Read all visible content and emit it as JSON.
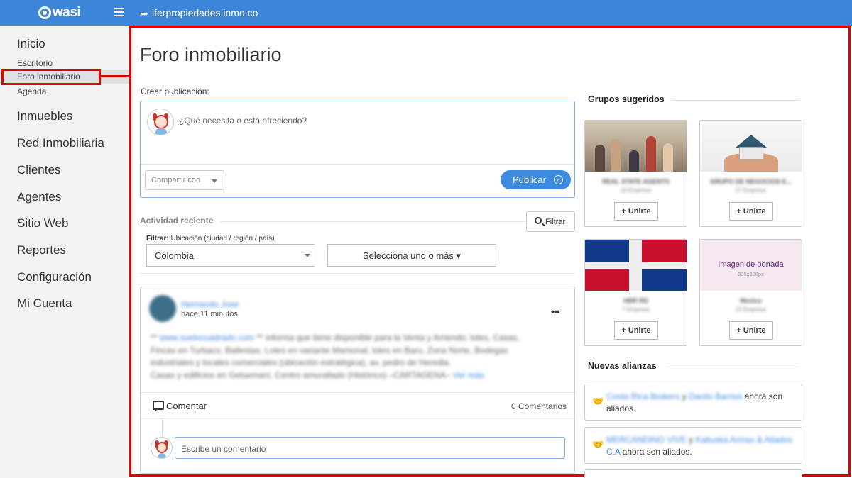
{
  "topbar": {
    "logo_text": "wasi",
    "domain": "iferpropiedades.inmo.co",
    "icons": [
      "menu-icon",
      "share-arrow-icon"
    ],
    "color": "#3d85d8"
  },
  "sidebar": {
    "section_inicio": "Inicio",
    "sub_escritorio": "Escritorio",
    "sub_foro": "Foro inmobiliario",
    "sub_agenda": "Agenda",
    "items": [
      "Inmuebles",
      "Red Inmobiliaria",
      "Clientes",
      "Agentes",
      "Sitio Web",
      "Reportes",
      "Configuración",
      "Mi Cuenta"
    ]
  },
  "main": {
    "title": "Foro inmobiliario",
    "create_label": "Crear publicación:",
    "post_placeholder": "¿Qué necesita o está ofreciendo?",
    "share_with": "Compartir con",
    "publish_label": "Publicar",
    "activity_label": "Actividad reciente",
    "filter_button": "Filtrar",
    "filter_caption_bold": "Filtrar:",
    "filter_caption": " Ubicación (ciudad / región / país)",
    "country_value": "Colombia",
    "multi_select_label": "Selecciona uno o más ▾"
  },
  "feed": {
    "poster_name": "Hernando Jose",
    "time": "hace 11 minutos",
    "more": "•••",
    "body_link": "www.suelocuadrado.com",
    "body_lines": [
      " ** informa que tiene disponible para la Venta y Arriendo: lotes, Casas,",
      "Fincas en Turbaco, Ballestas, Lotes en variante Mamonal, lotes en Baru, Zona Norte, Bodegas",
      "industriales y locales comerciales (ubicación estratégica), av. pedro de Heredia.",
      "Casas y edificios en Getsemaní, Centro amurallado (Histórico) –CARTAGENA–"
    ],
    "body_prefix": "** ",
    "see_more": " Ver más",
    "comment_label": "Comentar",
    "comment_count": "0 Comentarios",
    "comment_placeholder": "Escribe un comentario"
  },
  "groups": {
    "heading": "Grupos sugeridos",
    "join_label": "+ Unirte",
    "items": [
      {
        "name": "REAL STATE AGENTS",
        "meta": "16 Empresa"
      },
      {
        "name": "GRUPO DE NEGOCIOS E...",
        "meta": "27 Empresa"
      },
      {
        "name": "HBR RD",
        "meta": "7 Empresa"
      },
      {
        "name": "Mexico",
        "meta": "15 Empresa"
      }
    ],
    "cover_title": "Imagen de portada",
    "cover_size": "635x300px"
  },
  "alliances": {
    "heading": "Nuevas alianzas",
    "items": [
      {
        "a": "Costa Rica Brokers",
        "joiner": " y ",
        "b": "Danilo Barrios",
        "suffix_1": " ahora son",
        "suffix_2": "aliados."
      },
      {
        "a": "MERCANDINO VIVE",
        "joiner": " y ",
        "b": "Katiuska Armas & Aliados",
        "b2": "C.A",
        "suffix_2": " ahora son aliados."
      }
    ]
  }
}
